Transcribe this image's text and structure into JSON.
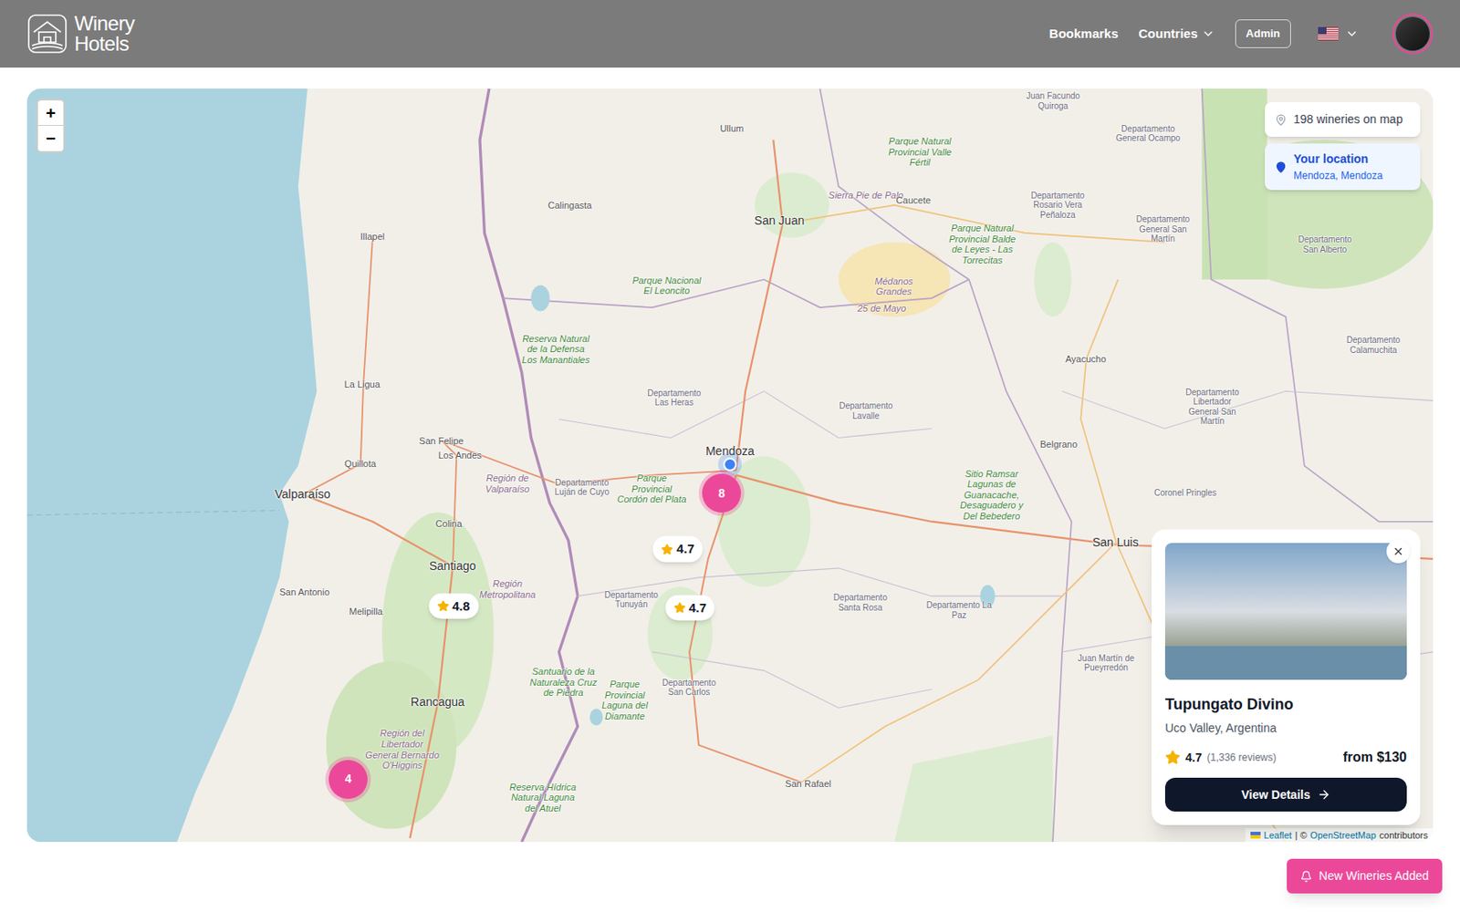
{
  "header": {
    "logo": [
      "Winery",
      "Hotels"
    ],
    "nav": [
      {
        "label": "Bookmarks",
        "kind": "link"
      },
      {
        "label": "Countries",
        "kind": "dropdown"
      },
      {
        "label": "Admin",
        "kind": "button"
      }
    ]
  },
  "map": {
    "zoom": [
      "+",
      "−"
    ],
    "count": "198 wineries on map",
    "location": {
      "title": "Your location",
      "subtitle": "Mendoza, Mendoza"
    },
    "labels": [
      {
        "text": "Ullum",
        "kind": "town"
      },
      {
        "text": "Calingasta",
        "kind": "town"
      },
      {
        "text": "San Juan",
        "kind": "city"
      },
      {
        "text": "Illapel",
        "kind": "town"
      },
      {
        "text": "Parque Nacional El Leoncito",
        "kind": "park"
      },
      {
        "text": "Reserva Natural de la Defensa Los Manantiales",
        "kind": "park"
      },
      {
        "text": "Sierra Pie de Palo",
        "kind": "region"
      },
      {
        "text": "Caucete",
        "kind": "town"
      },
      {
        "text": "Médanos Grandes",
        "kind": "region"
      },
      {
        "text": "25 de Mayo",
        "kind": "region"
      },
      {
        "text": "Parque Natural Provincial Valle Fértil",
        "kind": "park"
      },
      {
        "text": "Juan Facundo Quiroga",
        "kind": "dept"
      },
      {
        "text": "Departamento General Ocampo",
        "kind": "dept"
      },
      {
        "text": "Departamento Rosario Vera Peñaloza",
        "kind": "dept"
      },
      {
        "text": "Parque Natural Provincial Balde de Leyes - Las Torrecitas",
        "kind": "park"
      },
      {
        "text": "Departamento General San Martín",
        "kind": "dept"
      },
      {
        "text": "Departamento San Alberto",
        "kind": "dept"
      },
      {
        "text": "Departamento Calamuchita",
        "kind": "dept"
      },
      {
        "text": "Ayacucho",
        "kind": "town"
      },
      {
        "text": "La Ligua",
        "kind": "town"
      },
      {
        "text": "Departamento Las Heras",
        "kind": "dept"
      },
      {
        "text": "Departamento Lavalle",
        "kind": "dept"
      },
      {
        "text": "Departamento Libertador General San Martín",
        "kind": "dept"
      },
      {
        "text": "San Felipe",
        "kind": "town"
      },
      {
        "text": "Los Andes",
        "kind": "town"
      },
      {
        "text": "Quillota",
        "kind": "town"
      },
      {
        "text": "Belgrano",
        "kind": "town"
      },
      {
        "text": "Sitio Ramsar Lagunas de Guanacache, Desaguadero y Del Bebedero",
        "kind": "park"
      },
      {
        "text": "Valparaíso",
        "kind": "city"
      },
      {
        "text": "Región de Valparaíso",
        "kind": "region"
      },
      {
        "text": "Departamento Luján de Cuyo",
        "kind": "dept"
      },
      {
        "text": "Parque Provincial Cordón del Plata",
        "kind": "park"
      },
      {
        "text": "Mendoza",
        "kind": "city"
      },
      {
        "text": "Coronel Pringles",
        "kind": "dept"
      },
      {
        "text": "Colina",
        "kind": "town"
      },
      {
        "text": "San Luis",
        "kind": "city"
      },
      {
        "text": "Santiago",
        "kind": "city"
      },
      {
        "text": "San Antonio",
        "kind": "town"
      },
      {
        "text": "Región Metropolitana",
        "kind": "region"
      },
      {
        "text": "Melipilla",
        "kind": "town"
      },
      {
        "text": "Departamento Tunuyán",
        "kind": "dept"
      },
      {
        "text": "Departamento Santa Rosa",
        "kind": "dept"
      },
      {
        "text": "Departamento La Paz",
        "kind": "dept"
      },
      {
        "text": "Rancagua",
        "kind": "city"
      },
      {
        "text": "Santuario de la Naturaleza Cruz de Piedra",
        "kind": "park"
      },
      {
        "text": "Parque Provincial Laguna del Diamante",
        "kind": "park"
      },
      {
        "text": "Departamento San Carlos",
        "kind": "dept"
      },
      {
        "text": "Juan Martín de Pueyrredón",
        "kind": "dept"
      },
      {
        "text": "Región del Libertador General Bernardo O'Higgins",
        "kind": "region"
      },
      {
        "text": "Reserva Hídrica Natural Laguna del Atuel",
        "kind": "park"
      },
      {
        "text": "San Rafael",
        "kind": "town"
      }
    ],
    "clusters": [
      {
        "count": "8"
      },
      {
        "count": "4"
      }
    ],
    "ratings": [
      {
        "rating": "4.7"
      },
      {
        "rating": "4.8"
      },
      {
        "rating": "4.7"
      }
    ],
    "popup": {
      "title": "Tupungato Divino",
      "location": "Uco Valley, Argentina",
      "rating": "4.7",
      "reviews": "(1,336 reviews)",
      "price": "from $130",
      "button": "View Details"
    },
    "attribution": {
      "leaflet": "Leaflet",
      "separator": "| ©",
      "osm": "OpenStreetMap",
      "suffix": "contributors"
    }
  },
  "notification": "New Wineries Added"
}
